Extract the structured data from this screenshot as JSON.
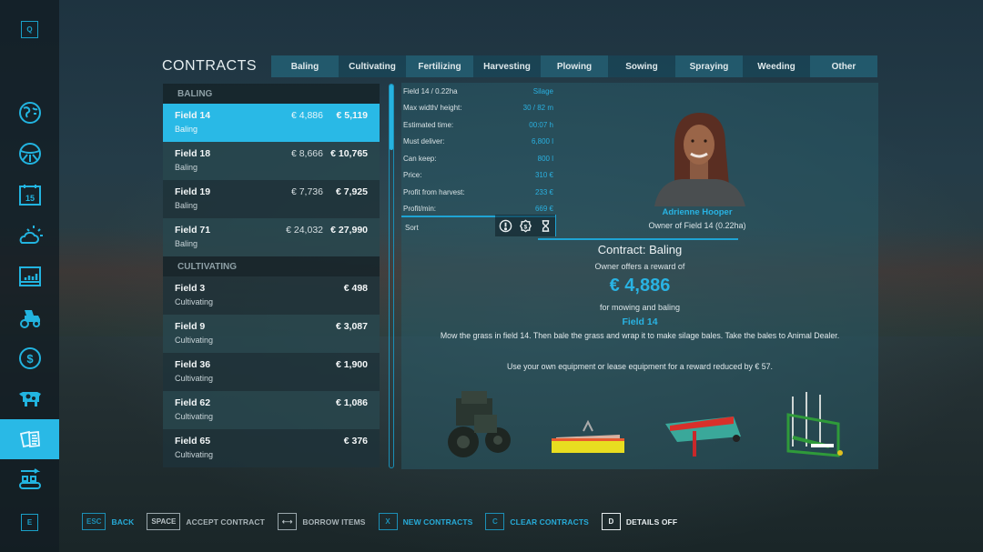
{
  "sidebar": {
    "top_key": "Q",
    "bottom_key": "E",
    "items": [
      {
        "icon": "map-icon"
      },
      {
        "icon": "steering-wheel-icon"
      },
      {
        "icon": "calendar-icon",
        "text": "15"
      },
      {
        "icon": "weather-icon"
      },
      {
        "icon": "statistics-icon"
      },
      {
        "icon": "tractor-icon"
      },
      {
        "icon": "finances-icon"
      },
      {
        "icon": "animals-icon"
      },
      {
        "icon": "contracts-icon",
        "active": true
      },
      {
        "icon": "production-icon"
      }
    ]
  },
  "header": {
    "title": "CONTRACTS",
    "tabs": [
      "Baling",
      "Cultivating",
      "Fertilizing",
      "Harvesting",
      "Plowing",
      "Sowing",
      "Spraying",
      "Weeding",
      "Other"
    ]
  },
  "list": {
    "sections": [
      {
        "title": "BALING",
        "rows": [
          {
            "field": "Field 14",
            "type": "Baling",
            "reward": "€ 4,886",
            "total": "€ 5,119",
            "selected": true
          },
          {
            "field": "Field 18",
            "type": "Baling",
            "reward": "€ 8,666",
            "total": "€ 10,765"
          },
          {
            "field": "Field 19",
            "type": "Baling",
            "reward": "€ 7,736",
            "total": "€ 7,925"
          },
          {
            "field": "Field 71",
            "type": "Baling",
            "reward": "€ 24,032",
            "total": "€ 27,990"
          }
        ]
      },
      {
        "title": "CULTIVATING",
        "rows": [
          {
            "field": "Field 3",
            "type": "Cultivating",
            "total": "€ 498"
          },
          {
            "field": "Field 9",
            "type": "Cultivating",
            "total": "€ 3,087"
          },
          {
            "field": "Field 36",
            "type": "Cultivating",
            "total": "€ 1,900"
          },
          {
            "field": "Field 62",
            "type": "Cultivating",
            "total": "€ 1,086"
          },
          {
            "field": "Field 65",
            "type": "Cultivating",
            "total": "€ 376"
          }
        ]
      }
    ]
  },
  "details": {
    "stats": [
      {
        "label": "Field 14 / 0.22ha",
        "value": "Silage"
      },
      {
        "label": "Max width/ height:",
        "value": "30 / 82 m"
      },
      {
        "label": "Estimated time:",
        "value": "00:07 h"
      },
      {
        "label": "Must deliver:",
        "value": "6,800 l"
      },
      {
        "label": "Can keep:",
        "value": "800 l"
      },
      {
        "label": "Price:",
        "value": "310 €"
      },
      {
        "label": "Profit from harvest:",
        "value": "233 €"
      },
      {
        "label": "Profit/min:",
        "value": "669 €"
      }
    ],
    "sort_label": "Sort",
    "sort_icons": [
      "exclamation-circle-icon",
      "money-icon",
      "hourglass-icon"
    ],
    "owner_name": "Adrienne Hooper",
    "owner_subtitle": "Owner of Field 14 (0.22ha)",
    "contract_title": "Contract: Baling",
    "offers_text": "Owner offers a reward of",
    "reward": "€ 4,886",
    "for_text": "for mowing and baling",
    "field": "Field 14",
    "description": "Mow the grass in field 14. Then bale the grass and wrap it to make silage bales. Take the bales to Animal Dealer.",
    "lease_text": "Use your own equipment or lease equipment for a reward reduced by € 57.",
    "equipment": [
      "tractor",
      "front-mower",
      "mower",
      "tedder"
    ]
  },
  "footer": [
    {
      "key": "ESC",
      "label": "BACK",
      "style": "blue"
    },
    {
      "key": "SPACE",
      "label": "ACCEPT CONTRACT",
      "style": "gray"
    },
    {
      "key": "⟷",
      "label": "BORROW ITEMS",
      "style": "gray"
    },
    {
      "key": "X",
      "label": "NEW CONTRACTS",
      "style": "blue"
    },
    {
      "key": "C",
      "label": "CLEAR CONTRACTS",
      "style": "blue"
    },
    {
      "key": "D",
      "label": "DETAILS OFF",
      "style": "white"
    }
  ]
}
